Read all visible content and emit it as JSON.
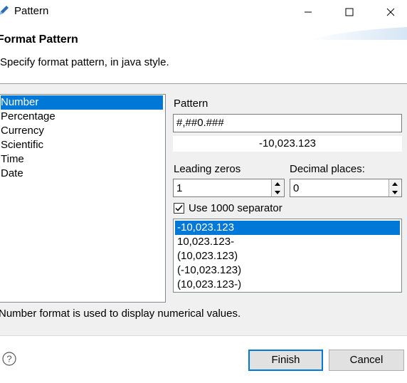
{
  "window": {
    "title": "Pattern",
    "icons": {
      "app": "pencil-icon",
      "minimize": "minimize-icon",
      "maximize": "maximize-icon",
      "close": "close-icon"
    }
  },
  "header": {
    "title": "Format Pattern",
    "description": "Specify format pattern, in java style."
  },
  "categories": {
    "items": [
      "Number",
      "Percentage",
      "Currency",
      "Scientific",
      "Time",
      "Date"
    ],
    "selected": "Number"
  },
  "pattern": {
    "label": "Pattern",
    "value": "#,##0.###",
    "preview": "-10,023.123"
  },
  "leading_zeros": {
    "label": "Leading zeros",
    "value": "1"
  },
  "decimal_places": {
    "label": "Decimal places:",
    "value": "0"
  },
  "separator": {
    "label": "Use 1000 separator",
    "checked": true
  },
  "negative_formats": {
    "items": [
      "-10,023.123",
      "10,023.123-",
      "(10,023.123)",
      "(-10,023.123)",
      "(10,023.123-)"
    ],
    "selected": "-10,023.123"
  },
  "info": "Number format is used to display numerical values.",
  "buttons": {
    "finish": "Finish",
    "cancel": "Cancel"
  },
  "colors": {
    "selection": "#0078d7",
    "panel": "#f0f0f0",
    "default_button_border": "#0078d7"
  }
}
